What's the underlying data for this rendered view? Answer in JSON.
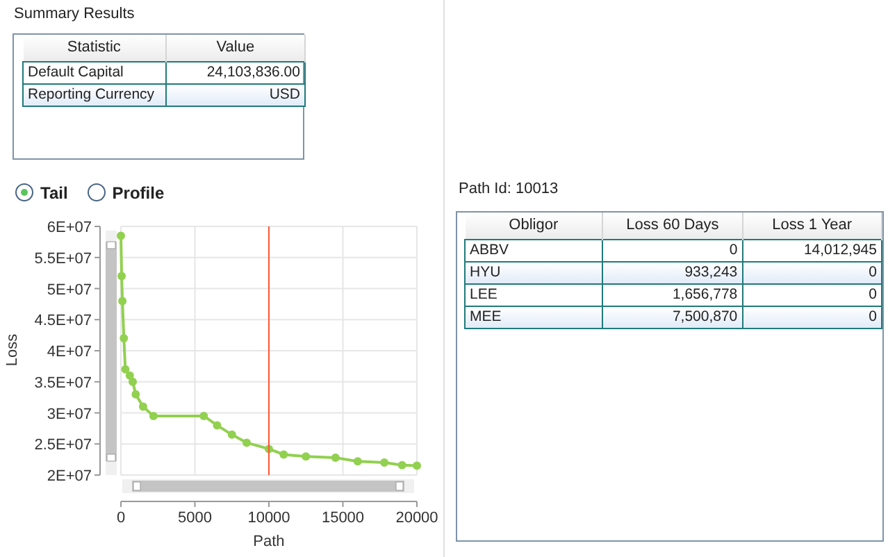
{
  "summary": {
    "title": "Summary Results",
    "columns": [
      "Statistic",
      "Value"
    ],
    "rows": [
      {
        "statistic": "Default Capital",
        "value": "24,103,836.00"
      },
      {
        "statistic": "Reporting Currency",
        "value": "USD"
      }
    ]
  },
  "view_options": [
    {
      "label": "Tail",
      "selected": true
    },
    {
      "label": "Profile",
      "selected": false
    }
  ],
  "chart": {
    "chart_data": {
      "type": "line",
      "xlabel": "Path",
      "ylabel": "Loss",
      "xlim": [
        0,
        20000
      ],
      "ylim": [
        20000000,
        60000000
      ],
      "xticks": [
        0,
        5000,
        10000,
        15000,
        20000
      ],
      "yticks": [
        {
          "value": 60000000,
          "label": "6E+07"
        },
        {
          "value": 55000000,
          "label": "5.5E+07"
        },
        {
          "value": 50000000,
          "label": "5E+07"
        },
        {
          "value": 45000000,
          "label": "4.5E+07"
        },
        {
          "value": 40000000,
          "label": "4E+07"
        },
        {
          "value": 35000000,
          "label": "3.5E+07"
        },
        {
          "value": 30000000,
          "label": "3E+07"
        },
        {
          "value": 25000000,
          "label": "2.5E+07"
        },
        {
          "value": 20000000,
          "label": "2E+07"
        }
      ],
      "x": [
        0,
        50,
        100,
        200,
        300,
        600,
        800,
        1000,
        1500,
        2200,
        5600,
        6500,
        7500,
        8500,
        10000,
        11000,
        12500,
        14500,
        16000,
        17800,
        19000,
        20000
      ],
      "grid": true,
      "series": [
        {
          "color": "#92d050",
          "marker": "circle",
          "values": [
            58500000,
            52000000,
            48000000,
            42000000,
            37000000,
            36000000,
            35000000,
            33000000,
            31000000,
            29500000,
            29500000,
            28000000,
            26500000,
            25200000,
            24200000,
            23300000,
            23000000,
            22800000,
            22200000,
            22000000,
            21600000,
            21500000
          ]
        }
      ],
      "ref_lines": [
        {
          "axis": "x",
          "value": 10000,
          "color": "#ff5533"
        }
      ]
    }
  },
  "path": {
    "label": "Path Id: 10013"
  },
  "obligors": {
    "columns": [
      "Obligor",
      "Loss 60 Days",
      "Loss 1 Year"
    ],
    "rows": [
      {
        "obligor": "ABBV",
        "loss_60_days": "0",
        "loss_1_year": "14,012,945"
      },
      {
        "obligor": "HYU",
        "loss_60_days": "933,243",
        "loss_1_year": "0"
      },
      {
        "obligor": "LEE",
        "loss_60_days": "1,656,778",
        "loss_1_year": "0"
      },
      {
        "obligor": "MEE",
        "loss_60_days": "7,500,870",
        "loss_1_year": "0"
      }
    ]
  }
}
